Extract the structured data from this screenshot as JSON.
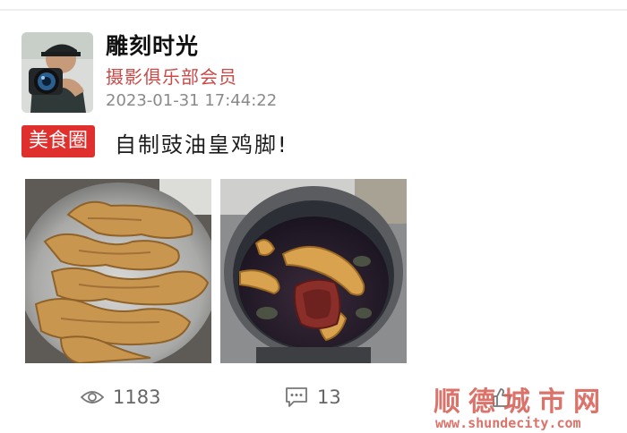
{
  "post": {
    "user": {
      "name": "雕刻时光",
      "title": "摄影俱乐部会员"
    },
    "timestamp": "2023-01-31 17:44:22",
    "topic_tag": "美食圈",
    "text": "自制豉油皇鸡脚!",
    "stats": {
      "views": "1183",
      "comments": "13",
      "likes": ""
    }
  },
  "watermark": {
    "title": "顺德城市网",
    "url": "www.shundecity.com"
  },
  "icons": {
    "views": "eye-icon",
    "comments": "comment-icon",
    "likes": "thumbs-up-icon"
  },
  "colors": {
    "topic_tag_bg": "#e0302e",
    "user_title": "#c94a47",
    "watermark": "#d66056"
  }
}
